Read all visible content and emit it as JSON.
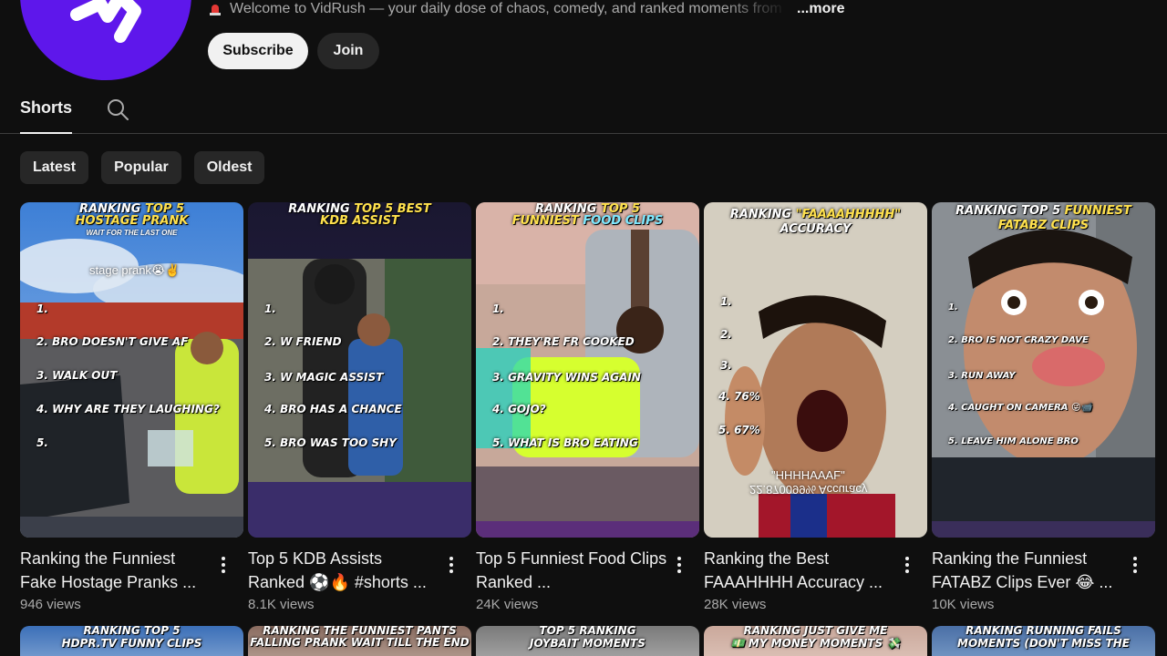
{
  "channel": {
    "description": "Welcome to VidRush — your daily dose of chaos, comedy, and ranked moments from",
    "more_label": "...more",
    "subscribe_label": "Subscribe",
    "join_label": "Join",
    "brand_color": "#5e17eb"
  },
  "tabs": {
    "shorts_label": "Shorts"
  },
  "chips": [
    "Latest",
    "Popular",
    "Oldest"
  ],
  "videos": [
    {
      "title": "Ranking the Funniest Fake Hostage Pranks ...",
      "views": "946 views",
      "thumb": {
        "line1a": "RANKING",
        "line1b": "TOP 5",
        "line2": "HOSTAGE PRANK",
        "line3": "WAIT FOR THE LAST ONE",
        "overlay": "stage prank😭✌️",
        "ranks": [
          "1.",
          "2. BRO DOESN'T GIVE AF",
          "3. WALK OUT",
          "4. WHY ARE THEY LAUGHING?",
          "5."
        ]
      }
    },
    {
      "title": "Top 5 KDB Assists Ranked ⚽️🔥 #shorts ...",
      "views": "8.1K views",
      "thumb": {
        "line1a": "RANKING",
        "line1b": "TOP 5 BEST",
        "line2": "KDB ASSIST",
        "ranks": [
          "1.",
          "2. W FRIEND",
          "3. W MAGIC ASSIST",
          "4. BRO HAS A CHANCE",
          "5. BRO WAS TOO SHY"
        ]
      }
    },
    {
      "title": "Top 5 Funniest Food Clips Ranked ...",
      "views": "24K views",
      "thumb": {
        "line1a": "RANKING",
        "line1b": "TOP 5",
        "line2a": "FUNNIEST",
        "line2b": "FOOD CLIPS",
        "ranks": [
          "1.",
          "2. THEY'RE FR COOKED",
          "3. GRAVITY WINS AGAIN",
          "4. GOJO?",
          "5. WHAT IS BRO EATING"
        ]
      }
    },
    {
      "title": "Ranking the Best FAAAHHHH Accuracy ...",
      "views": "28K views",
      "thumb": {
        "line1a": "RANKING",
        "line1b": "\"FAAAAHHHHH\"",
        "line2": "ACCURACY",
        "caption1": "\"HHHHAAAF\"",
        "caption2": "22.870099% Accuracy",
        "ranks": [
          "1.",
          "2.",
          "3.",
          "4. 76%",
          "5. 67%"
        ]
      }
    },
    {
      "title": "Ranking the Funniest FATABZ Clips Ever 😂 ...",
      "views": "10K views",
      "thumb": {
        "line1a": "RANKING TOP 5",
        "line1b": "FUNNIEST",
        "line2": "FATABZ CLIPS",
        "ranks": [
          "1.",
          "2. BRO IS NOT CRAZY DAVE",
          "3. RUN AWAY",
          "4. CAUGHT ON CAMERA 😜📹",
          "5. LEAVE HIM ALONE BRO"
        ]
      }
    }
  ],
  "row2": [
    {
      "line1": "RANKING TOP 5",
      "line2": "HDPR.TV FUNNY CLIPS"
    },
    {
      "line1": "RANKING THE FUNNIEST PANTS",
      "line2": "FALLING PRANK WAIT TILL THE END"
    },
    {
      "line1": "TOP 5 RANKING",
      "line2": "JOYBAIT MOMENTS"
    },
    {
      "line1": "RANKING JUST GIVE ME",
      "line2": "💵 MY MONEY MOMENTS 💸"
    },
    {
      "line1": "RANKING RUNNING FAILS",
      "line2": "MOMENTS (DON'T MISS THE"
    }
  ]
}
